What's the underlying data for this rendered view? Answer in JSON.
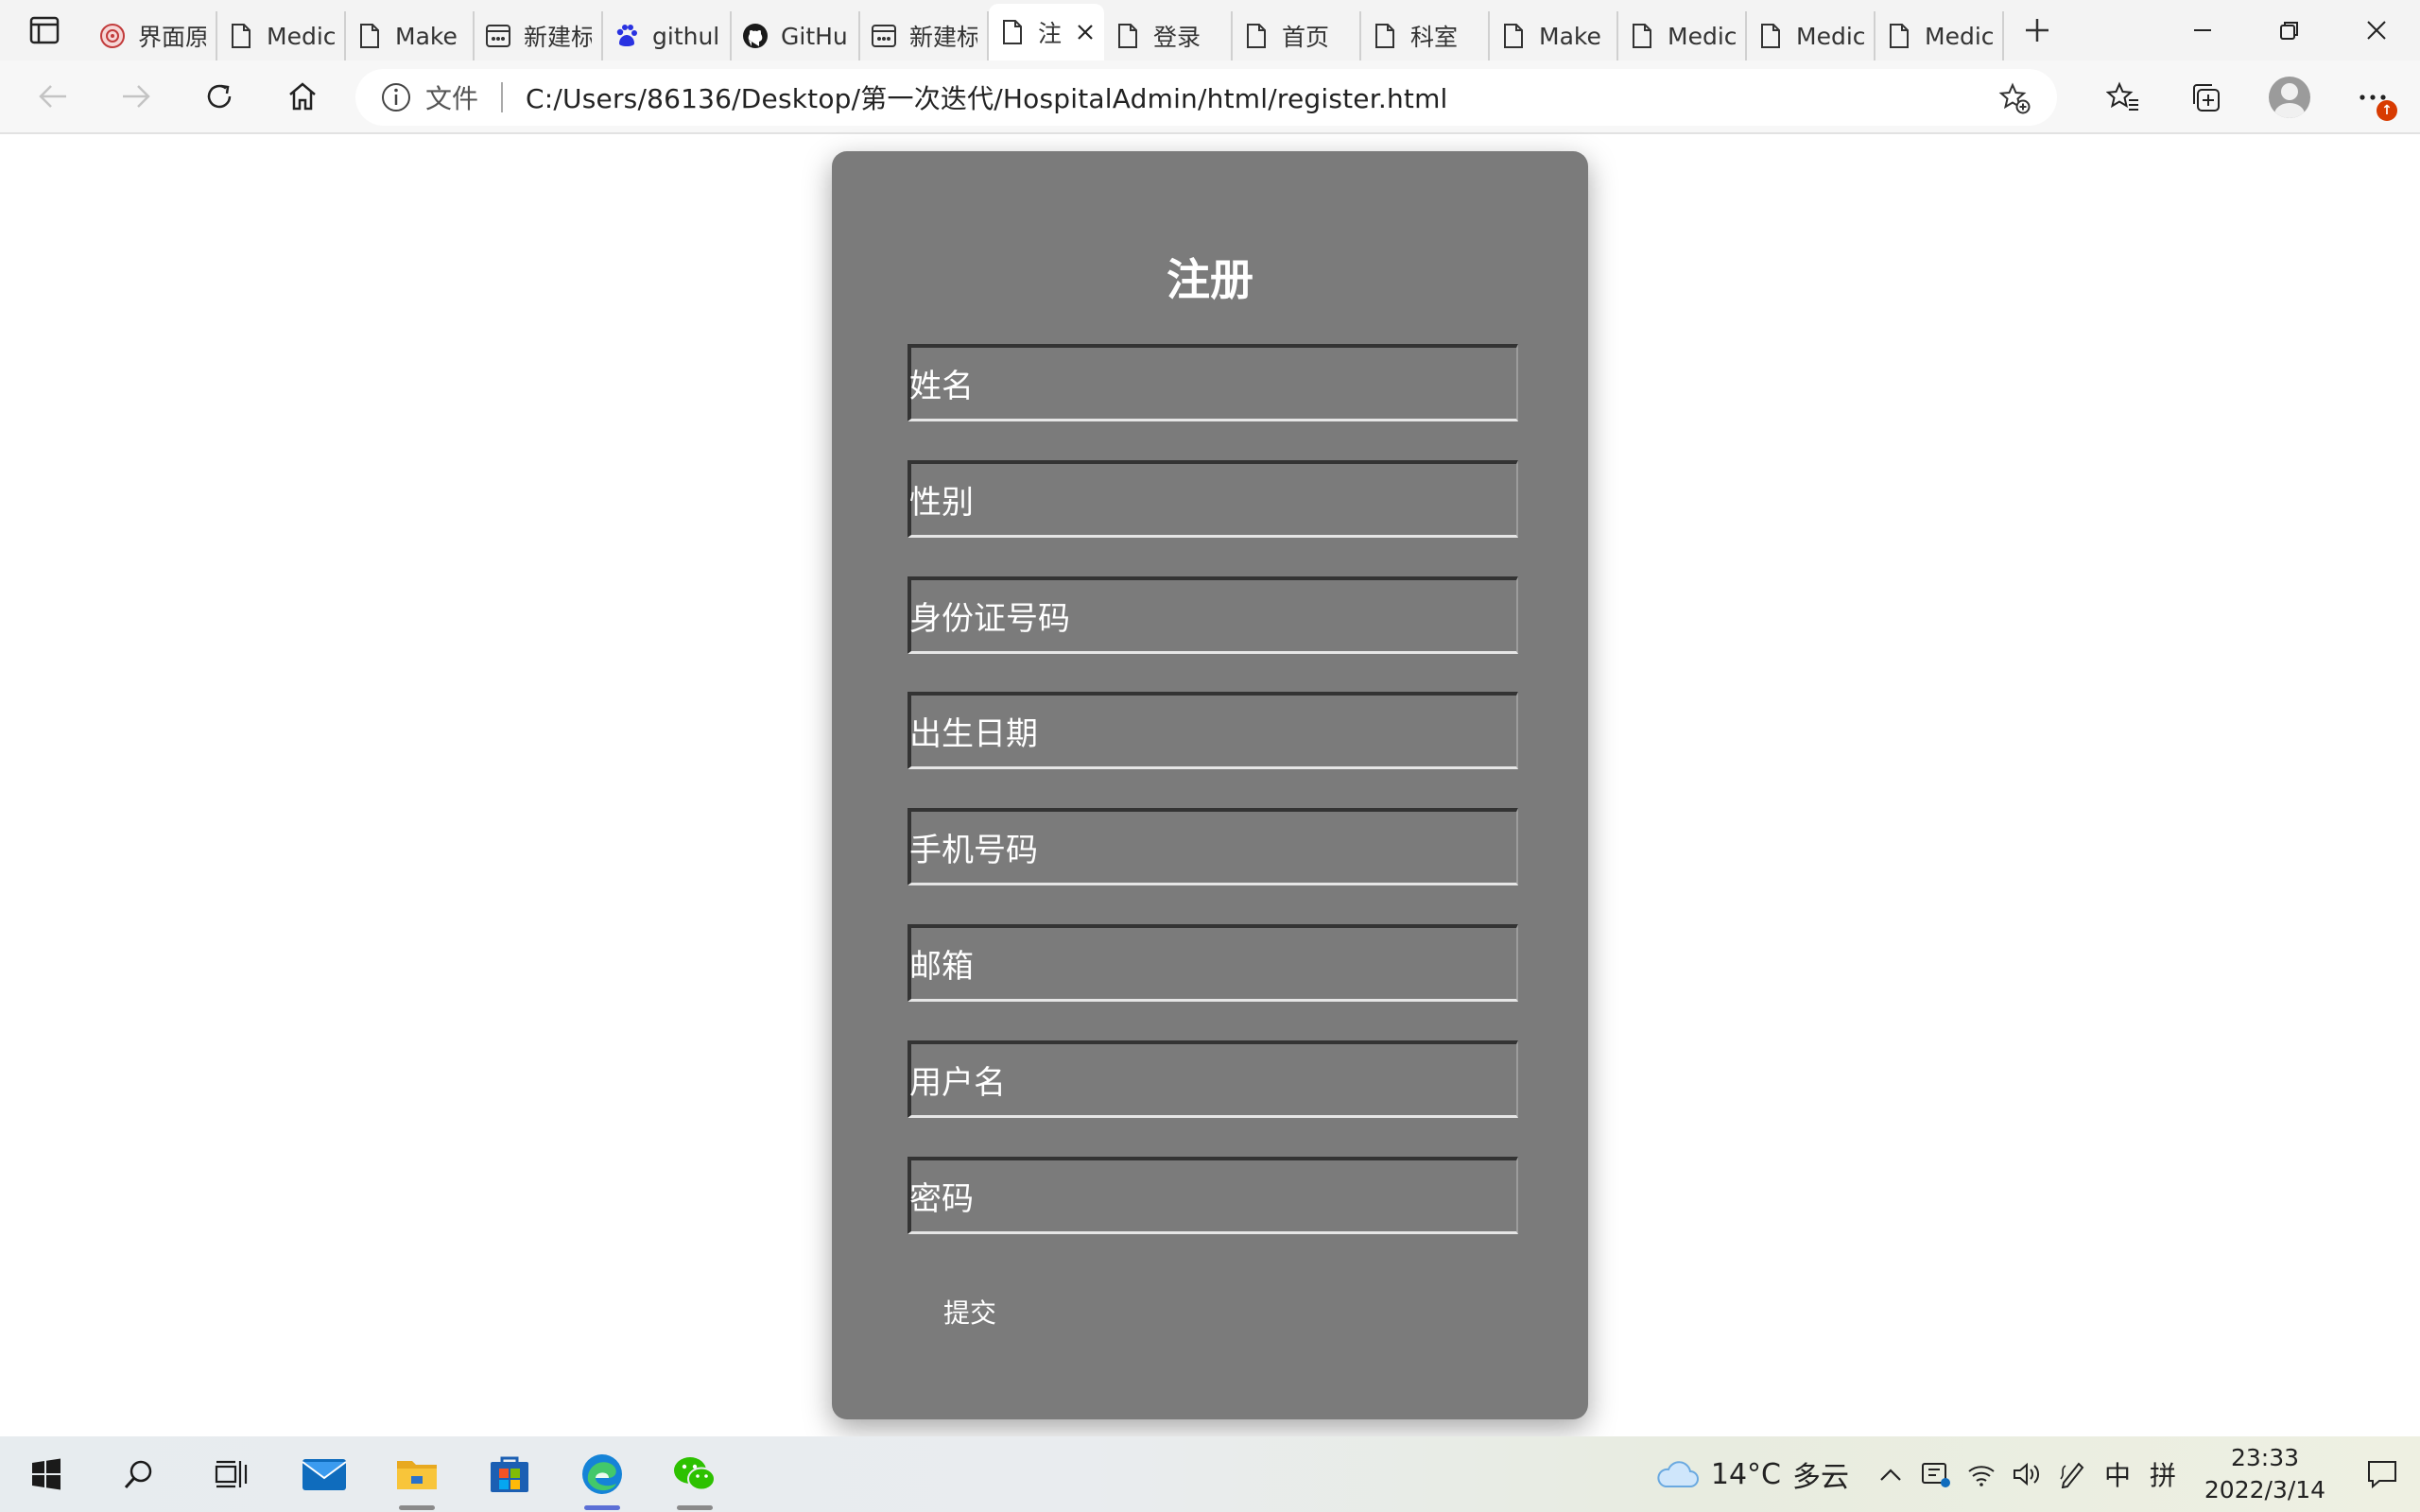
{
  "browser": {
    "tabs": [
      {
        "label": "界面原",
        "icon": "site-seal-icon"
      },
      {
        "label": "Medic",
        "icon": "page-icon"
      },
      {
        "label": "Make",
        "icon": "page-icon"
      },
      {
        "label": "新建标",
        "icon": "new-tab-page-icon"
      },
      {
        "label": "githul",
        "icon": "baidu-paw-icon"
      },
      {
        "label": "GitHu",
        "icon": "github-icon"
      },
      {
        "label": "新建标",
        "icon": "new-tab-page-icon"
      },
      {
        "label": "注",
        "icon": "page-icon",
        "active": true
      },
      {
        "label": "登录",
        "icon": "page-icon"
      },
      {
        "label": "首页",
        "icon": "page-icon"
      },
      {
        "label": "科室",
        "icon": "page-icon"
      },
      {
        "label": "Make",
        "icon": "page-icon"
      },
      {
        "label": "Medic",
        "icon": "page-icon"
      },
      {
        "label": "Medic",
        "icon": "page-icon"
      },
      {
        "label": "Medic",
        "icon": "page-icon"
      }
    ],
    "address": {
      "protocol_label": "文件",
      "url": "C:/Users/86136/Desktop/第一次迭代/HospitalAdmin/html/register.html"
    },
    "notification_badge": "↑"
  },
  "form": {
    "title": "注册",
    "fields": [
      {
        "placeholder": "姓名"
      },
      {
        "placeholder": "性别"
      },
      {
        "placeholder": "身份证号码"
      },
      {
        "placeholder": "出生日期"
      },
      {
        "placeholder": "手机号码"
      },
      {
        "placeholder": "邮箱"
      },
      {
        "placeholder": "用户名"
      },
      {
        "placeholder": "密码"
      }
    ],
    "submit_label": "提交"
  },
  "taskbar": {
    "apps": [
      "start-icon",
      "search-icon",
      "task-view-icon",
      "mail-icon",
      "file-explorer-icon",
      "store-icon",
      "edge-icon",
      "wechat-icon"
    ],
    "weather": {
      "temp": "14°C",
      "condition": "多云"
    },
    "ime_lang": "中",
    "ime_mode": "拼",
    "time": "23:33",
    "date": "2022/3/14"
  },
  "colors": {
    "card_bg": "#7b7b7b",
    "text": "#ffffff",
    "accent": "#5b6fd6"
  }
}
